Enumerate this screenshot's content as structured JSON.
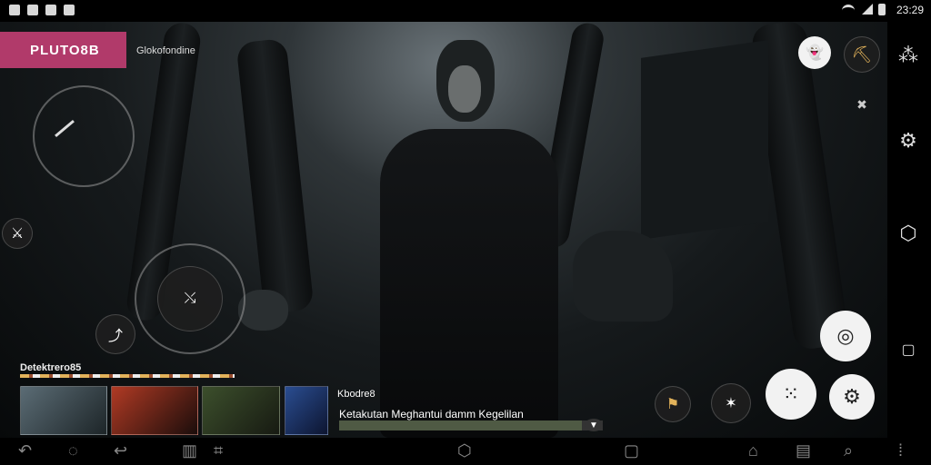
{
  "status_bar": {
    "time": "23:29",
    "left_icons": [
      "photo-icon",
      "image-icon",
      "gallery-icon",
      "notification-icon"
    ],
    "right_icons": [
      "wifi-icon",
      "signal-icon",
      "battery-icon"
    ]
  },
  "header": {
    "brand": "PLUTO8B",
    "channel_text": "Glokofondine"
  },
  "player_controls": {
    "left_stick": "joystick",
    "dpad": "direction-pad",
    "left_icons": [
      "sword-icon",
      "bow-icon"
    ],
    "right_buttons": [
      "ghost-icon",
      "pickaxe-icon",
      "close-icon",
      "bomb-icon",
      "nodes-icon",
      "gear-icon"
    ]
  },
  "side_rail": {
    "icons": [
      "share-icon",
      "settings-icon",
      "shield-icon",
      "square-icon"
    ]
  },
  "bottom_feed": {
    "title": "Detektrero85",
    "tag": "Kbodre8",
    "caption": "Ketakutan Meghantui damm Kegelilan",
    "progress": 0.92,
    "thumbnails": [
      "thumb-1",
      "thumb-2",
      "thumb-3",
      "thumb-4"
    ]
  },
  "nav_bar": {
    "items": [
      "back",
      "home",
      "undo",
      "forward",
      "apps",
      "home-center",
      "recent",
      "more"
    ]
  },
  "colors": {
    "brand": "#b13a6a",
    "scene_dark": "#07090a",
    "accent_gold": "#e2b25a"
  }
}
